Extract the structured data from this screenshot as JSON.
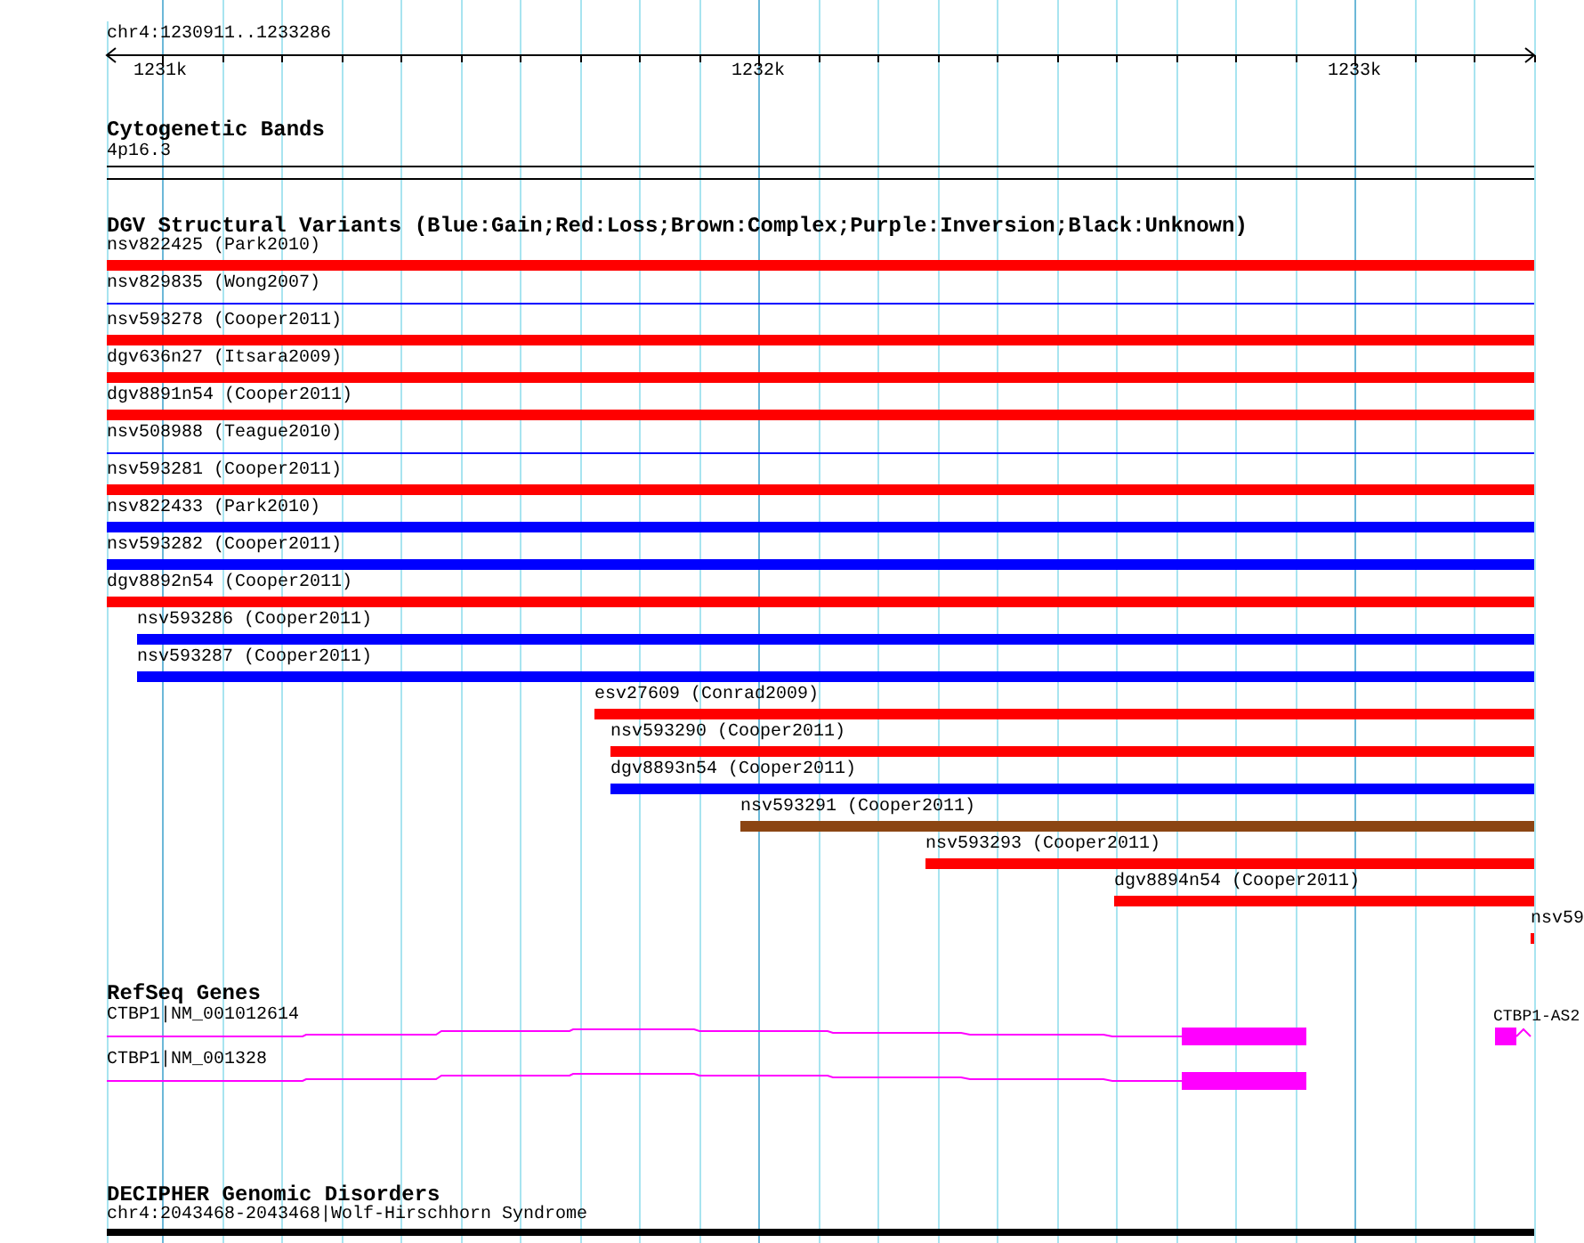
{
  "ruler": {
    "region": "chr4:1230911..1233286",
    "ticks": [
      "1231k",
      "1232k",
      "1233k"
    ]
  },
  "cytogenetic_bands": {
    "title": "Cytogenetic Bands",
    "band": "4p16.3"
  },
  "dgv": {
    "title": "DGV Structural Variants (Blue:Gain;Red:Loss;Brown:Complex;Purple:Inversion;Black:Unknown)",
    "variants": [
      {
        "label": "nsv822425 (Park2010)",
        "color": "#ff0000",
        "kind": "bar"
      },
      {
        "label": "nsv829835 (Wong2007)",
        "color": "#0000ff",
        "kind": "line"
      },
      {
        "label": "nsv593278 (Cooper2011)",
        "color": "#ff0000",
        "kind": "bar"
      },
      {
        "label": "dgv636n27 (Itsara2009)",
        "color": "#ff0000",
        "kind": "bar"
      },
      {
        "label": "dgv8891n54 (Cooper2011)",
        "color": "#ff0000",
        "kind": "bar"
      },
      {
        "label": "nsv508988 (Teague2010)",
        "color": "#0000ff",
        "kind": "line"
      },
      {
        "label": "nsv593281 (Cooper2011)",
        "color": "#ff0000",
        "kind": "bar"
      },
      {
        "label": "nsv822433 (Park2010)",
        "color": "#0000ff",
        "kind": "bar"
      },
      {
        "label": "nsv593282 (Cooper2011)",
        "color": "#0000ff",
        "kind": "bar"
      },
      {
        "label": "dgv8892n54 (Cooper2011)",
        "color": "#ff0000",
        "kind": "bar"
      },
      {
        "label": "nsv593286 (Cooper2011)",
        "color": "#0000ff",
        "kind": "bar"
      },
      {
        "label": "nsv593287 (Cooper2011)",
        "color": "#0000ff",
        "kind": "bar"
      },
      {
        "label": "esv27609 (Conrad2009)",
        "color": "#ff0000",
        "kind": "bar"
      },
      {
        "label": "nsv593290 (Cooper2011)",
        "color": "#ff0000",
        "kind": "bar"
      },
      {
        "label": "dgv8893n54 (Cooper2011)",
        "color": "#0000ff",
        "kind": "bar"
      },
      {
        "label": "nsv593291 (Cooper2011)",
        "color": "#8b4513",
        "kind": "bar"
      },
      {
        "label": "nsv593293 (Cooper2011)",
        "color": "#ff0000",
        "kind": "bar"
      },
      {
        "label": "dgv8894n54 (Cooper2011)",
        "color": "#ff0000",
        "kind": "bar"
      },
      {
        "label": "nsv59",
        "color": "#ff0000",
        "kind": "bar"
      }
    ]
  },
  "refseq_genes": {
    "title": "RefSeq Genes",
    "genes": [
      {
        "label": "CTBP1|NM_001012614"
      },
      {
        "label": "CTBP1|NM_001328"
      },
      {
        "label": "CTBP1-AS2"
      }
    ]
  },
  "decipher": {
    "title": "DECIPHER Genomic Disorders",
    "features": [
      {
        "label": "chr4:2043468-2043468|Wolf-Hirschhorn Syndrome"
      }
    ]
  }
}
